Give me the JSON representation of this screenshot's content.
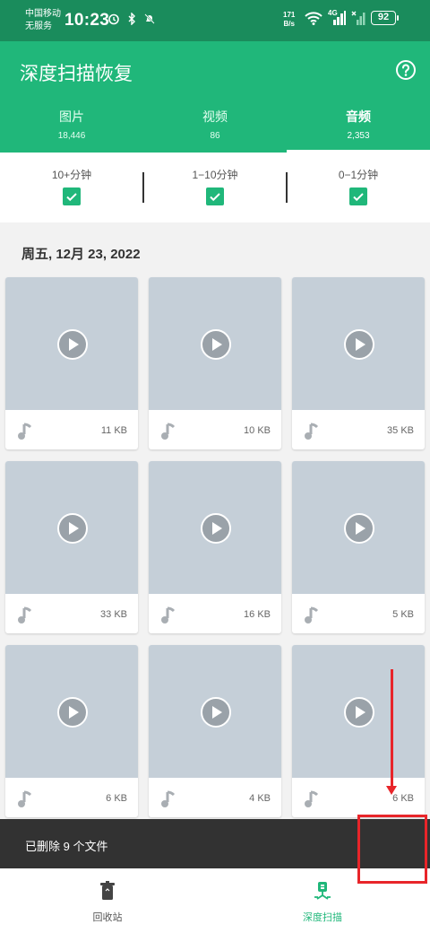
{
  "status_bar": {
    "carrier_line1": "中国移动",
    "carrier_line2": "无服务",
    "time": "10:23",
    "net_speed_value": "171",
    "net_speed_unit": "B/s",
    "network_type": "4G",
    "battery": "92"
  },
  "app_bar": {
    "title": "深度扫描恢复",
    "help_icon": "help-circle-icon"
  },
  "tabs": [
    {
      "label": "图片",
      "count": "18,446",
      "active": false
    },
    {
      "label": "视频",
      "count": "86",
      "active": false
    },
    {
      "label": "音频",
      "count": "2,353",
      "active": true
    }
  ],
  "filters": [
    {
      "label": "10+分钟",
      "checked": true
    },
    {
      "label": "1−10分钟",
      "checked": true
    },
    {
      "label": "0−1分钟",
      "checked": true
    }
  ],
  "date_header": "周五, 12月 23, 2022",
  "items": [
    {
      "size": "11 KB"
    },
    {
      "size": "10 KB"
    },
    {
      "size": "35 KB"
    },
    {
      "size": "33 KB"
    },
    {
      "size": "16 KB"
    },
    {
      "size": "5 KB"
    },
    {
      "size": "6 KB"
    },
    {
      "size": "4 KB"
    },
    {
      "size": "6 KB"
    }
  ],
  "snackbar": {
    "message": "已删除 9 个文件"
  },
  "bottom_nav": [
    {
      "label": "回收站",
      "icon": "trash-bin-icon",
      "active": false
    },
    {
      "label": "深度扫描",
      "icon": "scanner-icon",
      "active": true
    }
  ],
  "colors": {
    "status_bar": "#1a8c5c",
    "primary": "#20b77a",
    "thumb": "#c5cfd8",
    "snackbar": "#323232",
    "annotation": "#e8252a"
  }
}
